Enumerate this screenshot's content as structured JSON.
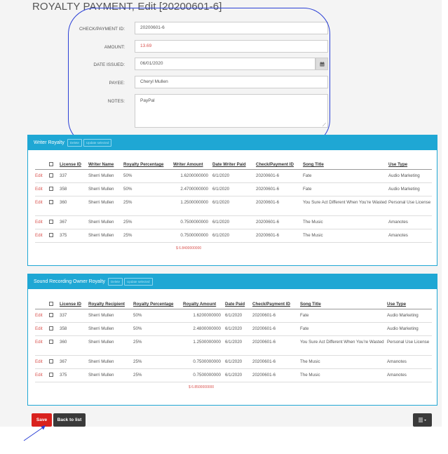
{
  "page": {
    "title": "ROYALTY PAYMENT, Edit [20200601-6]"
  },
  "form": {
    "check_id": {
      "label": "CHECK/PAYMENT ID:",
      "value": "20200601-6"
    },
    "amount": {
      "label": "AMOUNT:",
      "value": "13.69"
    },
    "date_issued": {
      "label": "DATE ISSUED:",
      "value": "06/01/2020"
    },
    "payee": {
      "label": "PAYEE:",
      "value": "Cheryl Mullen"
    },
    "notes": {
      "label": "NOTES:",
      "value": "PayPal"
    }
  },
  "writer_panel": {
    "title": "Writer Royalty",
    "btn_delete": "Delete",
    "btn_update": "Update selected",
    "headers": [
      "License ID",
      "Writer Name",
      "Royalty Percentage",
      "Writer Amount",
      "Date Writer Paid",
      "Check/Payment ID",
      "Song Title",
      "Use Type"
    ],
    "edit_label": "Edit",
    "rows": [
      [
        "337",
        "Sherri Mullen",
        "50%",
        "1.6200000000",
        "6/1/2020",
        "20200601-6",
        "Fate",
        "Audio Marketing"
      ],
      [
        "358",
        "Sherri Mullen",
        "50%",
        "2.4700000000",
        "6/1/2020",
        "20200601-6",
        "Fate",
        "Audio Marketing"
      ],
      [
        "360",
        "Sherri Mullen",
        "25%",
        "1.2500000000",
        "6/1/2020",
        "20200601-6",
        "You Sure Act Different When You're Wasted",
        "Personal Use License"
      ],
      [
        "367",
        "Sherri Mullen",
        "25%",
        "0.7500000000",
        "6/1/2020",
        "20200601-6",
        "The Music",
        "Amanotes"
      ],
      [
        "375",
        "Sherri Mullen",
        "25%",
        "0.7500000000",
        "6/1/2020",
        "20200601-6",
        "The Music",
        "Amanotes"
      ]
    ],
    "total": "$ 6.8400000000"
  },
  "sound_panel": {
    "title": "Sound Recording Owner Royalty",
    "btn_delete": "Delete",
    "btn_update": "Update selected",
    "headers": [
      "License ID",
      "Royalty Recipient",
      "Royalty Percentage",
      "Royalty Amount",
      "Date Paid",
      "Check/Payment ID",
      "Song Title",
      "Use Type"
    ],
    "edit_label": "Edit",
    "rows": [
      [
        "337",
        "Sherri Mullen",
        "50%",
        "1.6200000000",
        "6/1/2020",
        "20200601-6",
        "Fate",
        "Audio Marketing"
      ],
      [
        "358",
        "Sherri Mullen",
        "50%",
        "2.4800000000",
        "6/1/2020",
        "20200601-6",
        "Fate",
        "Audio Marketing"
      ],
      [
        "360",
        "Sherri Mullen",
        "25%",
        "1.2500000000",
        "6/1/2020",
        "20200601-6",
        "You Sure Act Different When You're Wasted",
        "Personal Use License"
      ],
      [
        "367",
        "Sherri Mullen",
        "25%",
        "0.7500000000",
        "6/1/2020",
        "20200601-6",
        "The Music",
        "Amanotes"
      ],
      [
        "375",
        "Sherri Mullen",
        "25%",
        "0.7500000000",
        "6/1/2020",
        "20200601-6",
        "The Music",
        "Amanotes"
      ]
    ],
    "total": "$ 6.8500000000"
  },
  "actions": {
    "save": "Save",
    "back": "Back to list",
    "menu_icon": "hamburger-caret-icon"
  },
  "colors": {
    "accent": "#1fa7d4",
    "danger": "#d9221e",
    "annotation": "#2b40d6"
  }
}
